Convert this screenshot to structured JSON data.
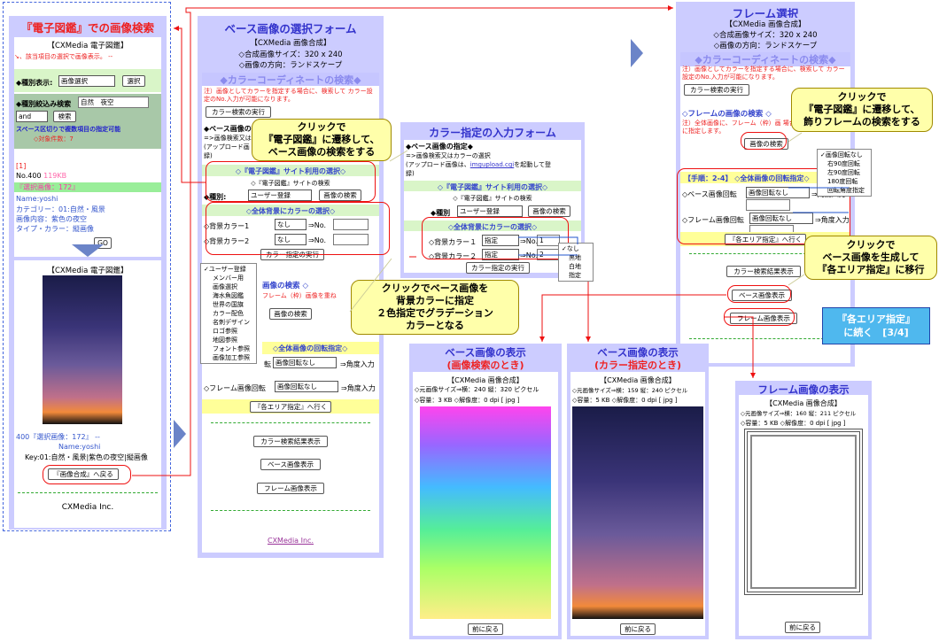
{
  "col1": {
    "title": "『電子図鑑』での画像検索",
    "app": "【CXMedia 電子図鑑】",
    "instruction": "↘、該当項目の選択で画像表示。 --",
    "display_label": "◆種別表示:",
    "display_select": "画像選択",
    "select_btn": "選択",
    "narrow_label": "◆種別絞込み検索",
    "narrow_value": "自然　夜空",
    "andor": "and",
    "search_btn": "検索",
    "space_note": "スペース区切りで複数項目の指定可能",
    "count_note": "◇対象件数：7",
    "item_index": "[1]",
    "item_no": "No.400",
    "item_size": "119KB",
    "item_selected": "『選択画像：172』",
    "item_name": "Name:yoshi",
    "item_category": "カテゴリー：01:自然・風景",
    "item_content": "画像内容：紫色の夜空",
    "item_type": "タイプ・カラー：縦画像",
    "go_btn": "GO",
    "viewer_app": "【CXMedia 電子図鑑】",
    "detail_line1": "400『選択画像：172』 --",
    "detail_name": "Name:yoshi",
    "detail_key": "Key:01:自然・風景|紫色の夜空|縦画像",
    "return_btn": "『画像合成』へ戻る",
    "footer": "CXMedia Inc."
  },
  "col2": {
    "title": "ベース画像の選択フォーム",
    "app": "【CXMedia 画像合成】",
    "size": "◇合成画像サイズ：320 x 240",
    "direction": "◇画像の方向：ランドスケープ",
    "color_search_title": "◆カラーコーディネートの検索◆",
    "note": "注）画像としてカラーを指定する場合に、検索して カラー設定のNo.入力が可能になります。",
    "color_btn": "カラー検索の実行",
    "base_spec": "◆ベース画像の指定◆",
    "base_note1": "=>画像検索又はカ",
    "base_note2": "(アップロード画",
    "base_note3": "録)",
    "site_title": "◇『電子図鑑』サイト利用の選択◇",
    "site_search": "◇『電子図鑑』サイトの検索",
    "kind_label": "◆種別:",
    "kind_select": "ユーザー登録",
    "image_search_btn": "画像の検索",
    "bg_title": "◇全体背景にカラーの選択◇",
    "bg1_label": "◇背景カラー1",
    "bg1_select": "なし",
    "bg1_arrow": "⇒No.",
    "bg2_label": "◇背景カラー2",
    "bg2_select": "なし",
    "bg2_arrow": "⇒No.",
    "color_exec_btn": "カラー指定の実行",
    "frame_search": "画像の検索 ◇",
    "frame_note": "フレーム（枠）画像を重ね",
    "frame_img_btn": "画像の検索",
    "rotate_title": "◇全体画像の回転指定◇",
    "rotate_label": "転",
    "rotate_select": "画像回転なし",
    "rotate_arrow": "⇒角度入力",
    "frame_rot_label": "◇フレーム画像回転",
    "frame_rot_select": "画像回転なし",
    "frame_rot_arrow": "⇒角度入力",
    "area_btn": "『各エリア指定』へ行く",
    "result_btn": "カラー検索結果表示",
    "base_show_btn": "ベース画像表示",
    "frame_show_btn": "フレーム画像表示",
    "footer": "CXMedia Inc.",
    "menu_items": [
      "✓ユーザー登録",
      "メンバー用",
      "画像選択",
      "海水魚図鑑",
      "世界の国旗",
      "カラー配色",
      "名刺デザイン",
      "ロゴ参照",
      "地図参照",
      "フォント参照",
      "画像加工参照"
    ]
  },
  "callout1": "クリックで\n『電子図鑑』に遷移して、\nベース画像の検索をする",
  "callout2": "クリックでベース画像を\n背景カラーに指定\n２色指定でグラデーション\nカラーとなる",
  "colorform": {
    "title": "カラー指定の入力フォーム",
    "base_spec": "◆ベース画像の指定◆",
    "note1": "=>画像検索又はカラーの選択",
    "note2": "(アップロード画像は、",
    "note_link": "imgupload.cgi",
    "note3": "を起動して登",
    "note4": "録)",
    "site_title": "◇『電子図鑑』サイト利用の選択◇",
    "site_search": "◇『電子図鑑』サイトの検索",
    "kind_label": "◆種別",
    "kind_select": "ユーザー登録",
    "image_search_btn": "画像の検索",
    "bg_title": "◇全体背景にカラーの選択◇",
    "bg1_label": "◇背景カラー１",
    "bg1_select": "指定",
    "bg1_no": "1",
    "bg2_label": "◇背景カラー２",
    "bg2_select": "指定",
    "bg2_no": "2",
    "arrow": "⇒No.",
    "exec_btn": "カラー指定の実行",
    "color_menu": [
      "✓なし",
      "黒地",
      "白地",
      "指定"
    ]
  },
  "col3": {
    "title": "フレーム選択",
    "app": "【CXMedia 画像合成】",
    "size": "◇合成画像サイズ：320 x 240",
    "direction": "◇画像の方向：ランドスケープ",
    "color_search_title": "◆カラーコーディネートの検索◆",
    "note": "注）画像としてカラーを指定する場合に、検索して カラー設定のNo.入力が可能になります。",
    "color_btn": "カラー検索の実行",
    "frame_search_title": "◇フレームの画像の検索 ◇",
    "frame_note": "注）全体画像に、フレーム（枠）画 場合に指定します。",
    "frame_img_btn": "画像の検索",
    "step": "【手順：2-4】 ◇全体画像の回転指定◇",
    "base_rot_label": "◇ベース画像回転",
    "base_rot_select": "画像回転なし",
    "angle": "⇒角度入力",
    "frame_rot_label": "◇フレーム画像回転",
    "frame_rot_select": "画像回転なし",
    "area_btn": "『各エリア指定』へ行く",
    "result_btn": "カラー検索結果表示",
    "base_show_btn": "ベース画像表示",
    "frame_show_btn": "フレーム画像表示",
    "rotate_menu": [
      "✓画像回転なし",
      "右90度回転",
      "左90度回転",
      "180度回転",
      "回転角度指定"
    ]
  },
  "callout3": "クリックで\n『電子図鑑』に遷移して、\n飾りフレームの検索をする",
  "callout4": "クリックで\nベース画像を生成して\n『各エリア指定』に移行",
  "continue": "『各エリア指定』\nに続く　[3/4]",
  "show1": {
    "title": "ベース画像の表示",
    "subtitle": "(画像検索のとき)",
    "app": "【CXMedia 画像合成】",
    "dims": "◇元画像サイズ⇒横：240 縦：320 ピクセル",
    "cap": "◇容量：3 KB ◇解像度：0 dpi [ jpg ]",
    "back_btn": "前に戻る"
  },
  "show2": {
    "title": "ベース画像の表示",
    "subtitle": "(カラー指定のとき)",
    "app": "【CXMedia 画像合成】",
    "dims": "◇元画像サイズ⇒横：159 縦：240 ピクセル",
    "cap": "◇容量：5 KB ◇解像度：0 dpi [ jpg ]",
    "back_btn": "前に戻る"
  },
  "show3": {
    "title": "フレーム画像の表示",
    "app": "【CXMedia 画像合成】",
    "dims": "◇元画像サイズ⇒横：160 縦：211 ピクセル",
    "cap": "◇容量：5 KB ◇解像度：0 dpi [ jpg ]",
    "back_btn": "前に戻る"
  },
  "colors": {
    "panel": "#ccccff",
    "accent_red": "#ee1111",
    "callout_bg": "#ffff99",
    "continue_bg": "#4fb8ee",
    "arrow": "#6b84c8",
    "title_blue": "#3333cc"
  }
}
